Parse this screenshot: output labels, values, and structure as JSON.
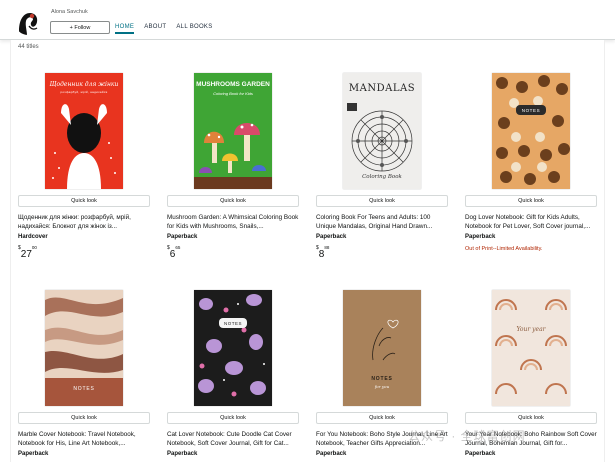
{
  "header": {
    "author_name": "Alona Savchuk",
    "follow_label": "+ Follow",
    "nav": [
      {
        "label": "HOME",
        "active": true
      },
      {
        "label": "ABOUT",
        "active": false
      },
      {
        "label": "ALL BOOKS",
        "active": false
      }
    ]
  },
  "results": {
    "count_text": "44 titles"
  },
  "books": [
    {
      "cover_title": "Щоденник для жінки",
      "cover_subtitle": "розфарбуй, мрій, надихайся",
      "quick_look": "Quick look",
      "title": "Щоденник для жінки: розфарбуй, мрій, надихайся: Блокнот для жінок із...",
      "format": "Hardcover",
      "price": {
        "symbol": "$",
        "whole": "27",
        "fraction": "00"
      }
    },
    {
      "cover_title": "MUSHROOMS GARDEN",
      "cover_subtitle": "Coloring Book for Kids",
      "quick_look": "Quick look",
      "title": "Mushroom Garden: A Whimsical Coloring Book for Kids with Mushrooms, Snails,...",
      "format": "Paperback",
      "price": {
        "symbol": "$",
        "whole": "6",
        "fraction": "65"
      }
    },
    {
      "cover_title": "MANDALAS",
      "cover_subtitle": "Coloring Book",
      "quick_look": "Quick look",
      "title": "Coloring Book For Teens and Adults: 100 Unique Mandalas, Original Hand Drawn...",
      "format": "Paperback",
      "price": {
        "symbol": "$",
        "whole": "8",
        "fraction": "88"
      }
    },
    {
      "cover_title": "NOTES",
      "quick_look": "Quick look",
      "title": "Dog Lover Notebook: Gift for Kids Adults, Notebook for Pet Lover, Soft Cover journal,...",
      "format": "Paperback",
      "availability": "Out of Print--Limited Availability."
    },
    {
      "cover_title": "NOTES",
      "quick_look": "Quick look",
      "title": "Marble Cover Notebook: Travel Notebook, Notebook for His, Line Art Notebook,...",
      "format": "Paperback"
    },
    {
      "cover_title": "NOTES",
      "quick_look": "Quick look",
      "title": "Cat Lover Notebook: Cute Doodle Cat Cover Notebook, Soft Cover Journal, Gift for Cat...",
      "format": "Paperback"
    },
    {
      "cover_title": "NOTES",
      "cover_subtitle": "for you",
      "quick_look": "Quick look",
      "title": "For You Notebook: Boho Style Journal, Line Art Notebook, Teacher Gifts Appreciation...",
      "format": "Paperback"
    },
    {
      "cover_title": "Your year",
      "quick_look": "Quick look",
      "title": "Your Year Notebook: Boho Rainbow Soft Cover Journal, Bohemian Journal, Gift for...",
      "format": "Paperback"
    }
  ],
  "watermark": "公众号 · 全球富创网"
}
